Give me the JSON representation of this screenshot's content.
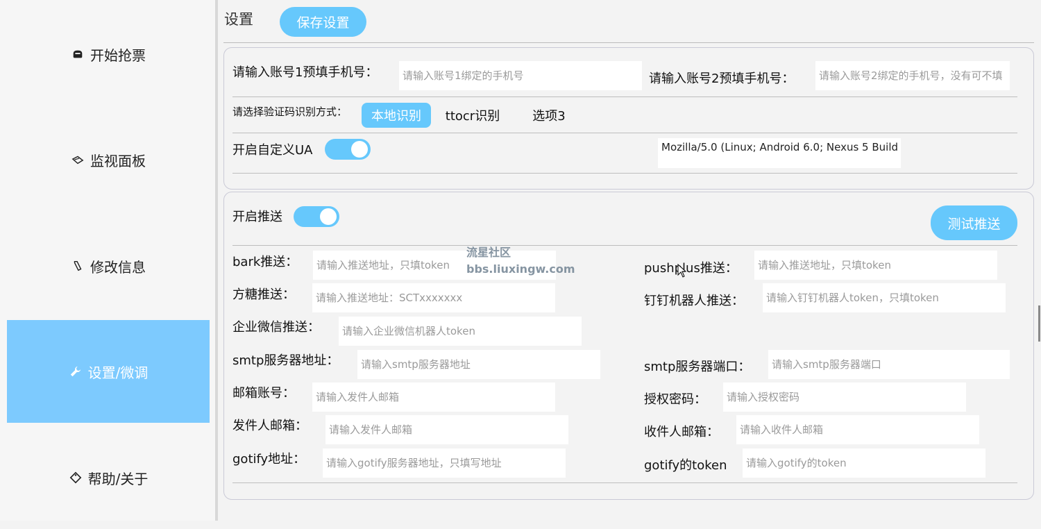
{
  "sidebar": {
    "items": [
      {
        "label": "开始抢票",
        "icon": "ticket-icon"
      },
      {
        "label": "监视面板",
        "icon": "dashboard-icon"
      },
      {
        "label": "修改信息",
        "icon": "edit-icon"
      },
      {
        "label": "设置/微调",
        "icon": "wrench-icon",
        "active": true
      },
      {
        "label": "帮助/关于",
        "icon": "tag-icon"
      }
    ]
  },
  "header": {
    "title": "设置",
    "save_label": "保存设置"
  },
  "account": {
    "phone1_label": "请输入账号1预填手机号：",
    "phone1_placeholder": "请输入账号1绑定的手机号",
    "phone2_label": "请输入账号2预填手机号：",
    "phone2_placeholder": "请输入账号2绑定的手机号，没有可不填"
  },
  "captcha": {
    "label": "请选择验证码识别方式：",
    "options": [
      "本地识别",
      "ttocr识别",
      "选项3"
    ],
    "selected": "本地识别"
  },
  "ua": {
    "label": "开启自定义UA",
    "enabled": true,
    "value": "Mozilla/5.0 (Linux; Android 6.0; Nexus 5 Build"
  },
  "push": {
    "enable_label": "开启推送",
    "enabled": true,
    "test_label": "测试推送",
    "fields": {
      "bark": {
        "label": "bark推送：",
        "placeholder": "请输入推送地址，只填token"
      },
      "pushplus": {
        "label": "pushplus推送：",
        "placeholder": "请输入推送地址，只填token"
      },
      "fangtang": {
        "label": "方糖推送：",
        "placeholder": "请输入推送地址：SCTxxxxxxx"
      },
      "dingtalk": {
        "label": "钉钉机器人推送：",
        "placeholder": "请输入钉钉机器人token，只填token"
      },
      "wecom": {
        "label": "企业微信推送：",
        "placeholder": "请输入企业微信机器人token"
      },
      "smtp_host": {
        "label": "smtp服务器地址：",
        "placeholder": "请输入smtp服务器地址"
      },
      "smtp_port": {
        "label": "smtp服务器端口：",
        "placeholder": "请输入smtp服务器端口"
      },
      "mail_account": {
        "label": "邮箱账号：",
        "placeholder": "请输入发件人邮箱"
      },
      "auth_code": {
        "label": "授权密码：",
        "placeholder": "请输入授权密码"
      },
      "sender": {
        "label": "发件人邮箱：",
        "placeholder": "请输入发件人邮箱"
      },
      "receiver": {
        "label": "收件人邮箱：",
        "placeholder": "请输入收件人邮箱"
      },
      "gotify_url": {
        "label": "gotify地址：",
        "placeholder": "请输入gotify服务器地址，只填写地址"
      },
      "gotify_token": {
        "label": "gotify的token",
        "placeholder": "请输入gotify的token"
      }
    }
  },
  "watermark": {
    "line1": "流星社区",
    "line2": "bbs.liuxingw.com"
  },
  "colors": {
    "accent": "#66c8fc",
    "active_nav": "#7dcafe"
  }
}
